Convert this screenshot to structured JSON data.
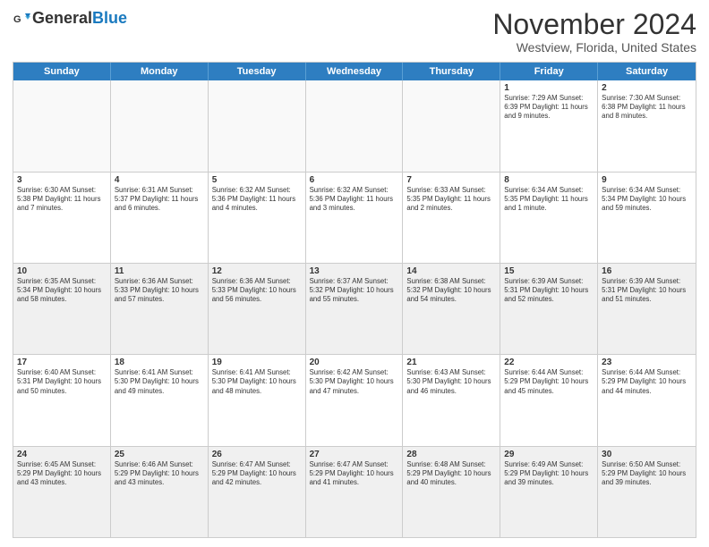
{
  "header": {
    "logo_general": "General",
    "logo_blue": "Blue",
    "month": "November 2024",
    "location": "Westview, Florida, United States"
  },
  "weekdays": [
    "Sunday",
    "Monday",
    "Tuesday",
    "Wednesday",
    "Thursday",
    "Friday",
    "Saturday"
  ],
  "weeks": [
    [
      {
        "day": "",
        "empty": true
      },
      {
        "day": "",
        "empty": true
      },
      {
        "day": "",
        "empty": true
      },
      {
        "day": "",
        "empty": true
      },
      {
        "day": "",
        "empty": true
      },
      {
        "day": "1",
        "info": "Sunrise: 7:29 AM\nSunset: 6:39 PM\nDaylight: 11 hours and 9 minutes."
      },
      {
        "day": "2",
        "info": "Sunrise: 7:30 AM\nSunset: 6:38 PM\nDaylight: 11 hours and 8 minutes."
      }
    ],
    [
      {
        "day": "3",
        "info": "Sunrise: 6:30 AM\nSunset: 5:38 PM\nDaylight: 11 hours and 7 minutes."
      },
      {
        "day": "4",
        "info": "Sunrise: 6:31 AM\nSunset: 5:37 PM\nDaylight: 11 hours and 6 minutes."
      },
      {
        "day": "5",
        "info": "Sunrise: 6:32 AM\nSunset: 5:36 PM\nDaylight: 11 hours and 4 minutes."
      },
      {
        "day": "6",
        "info": "Sunrise: 6:32 AM\nSunset: 5:36 PM\nDaylight: 11 hours and 3 minutes."
      },
      {
        "day": "7",
        "info": "Sunrise: 6:33 AM\nSunset: 5:35 PM\nDaylight: 11 hours and 2 minutes."
      },
      {
        "day": "8",
        "info": "Sunrise: 6:34 AM\nSunset: 5:35 PM\nDaylight: 11 hours and 1 minute."
      },
      {
        "day": "9",
        "info": "Sunrise: 6:34 AM\nSunset: 5:34 PM\nDaylight: 10 hours and 59 minutes."
      }
    ],
    [
      {
        "day": "10",
        "info": "Sunrise: 6:35 AM\nSunset: 5:34 PM\nDaylight: 10 hours and 58 minutes.",
        "shaded": true
      },
      {
        "day": "11",
        "info": "Sunrise: 6:36 AM\nSunset: 5:33 PM\nDaylight: 10 hours and 57 minutes.",
        "shaded": true
      },
      {
        "day": "12",
        "info": "Sunrise: 6:36 AM\nSunset: 5:33 PM\nDaylight: 10 hours and 56 minutes.",
        "shaded": true
      },
      {
        "day": "13",
        "info": "Sunrise: 6:37 AM\nSunset: 5:32 PM\nDaylight: 10 hours and 55 minutes.",
        "shaded": true
      },
      {
        "day": "14",
        "info": "Sunrise: 6:38 AM\nSunset: 5:32 PM\nDaylight: 10 hours and 54 minutes.",
        "shaded": true
      },
      {
        "day": "15",
        "info": "Sunrise: 6:39 AM\nSunset: 5:31 PM\nDaylight: 10 hours and 52 minutes.",
        "shaded": true
      },
      {
        "day": "16",
        "info": "Sunrise: 6:39 AM\nSunset: 5:31 PM\nDaylight: 10 hours and 51 minutes.",
        "shaded": true
      }
    ],
    [
      {
        "day": "17",
        "info": "Sunrise: 6:40 AM\nSunset: 5:31 PM\nDaylight: 10 hours and 50 minutes."
      },
      {
        "day": "18",
        "info": "Sunrise: 6:41 AM\nSunset: 5:30 PM\nDaylight: 10 hours and 49 minutes."
      },
      {
        "day": "19",
        "info": "Sunrise: 6:41 AM\nSunset: 5:30 PM\nDaylight: 10 hours and 48 minutes."
      },
      {
        "day": "20",
        "info": "Sunrise: 6:42 AM\nSunset: 5:30 PM\nDaylight: 10 hours and 47 minutes."
      },
      {
        "day": "21",
        "info": "Sunrise: 6:43 AM\nSunset: 5:30 PM\nDaylight: 10 hours and 46 minutes."
      },
      {
        "day": "22",
        "info": "Sunrise: 6:44 AM\nSunset: 5:29 PM\nDaylight: 10 hours and 45 minutes."
      },
      {
        "day": "23",
        "info": "Sunrise: 6:44 AM\nSunset: 5:29 PM\nDaylight: 10 hours and 44 minutes."
      }
    ],
    [
      {
        "day": "24",
        "info": "Sunrise: 6:45 AM\nSunset: 5:29 PM\nDaylight: 10 hours and 43 minutes.",
        "shaded": true
      },
      {
        "day": "25",
        "info": "Sunrise: 6:46 AM\nSunset: 5:29 PM\nDaylight: 10 hours and 43 minutes.",
        "shaded": true
      },
      {
        "day": "26",
        "info": "Sunrise: 6:47 AM\nSunset: 5:29 PM\nDaylight: 10 hours and 42 minutes.",
        "shaded": true
      },
      {
        "day": "27",
        "info": "Sunrise: 6:47 AM\nSunset: 5:29 PM\nDaylight: 10 hours and 41 minutes.",
        "shaded": true
      },
      {
        "day": "28",
        "info": "Sunrise: 6:48 AM\nSunset: 5:29 PM\nDaylight: 10 hours and 40 minutes.",
        "shaded": true
      },
      {
        "day": "29",
        "info": "Sunrise: 6:49 AM\nSunset: 5:29 PM\nDaylight: 10 hours and 39 minutes.",
        "shaded": true
      },
      {
        "day": "30",
        "info": "Sunrise: 6:50 AM\nSunset: 5:29 PM\nDaylight: 10 hours and 39 minutes.",
        "shaded": true
      }
    ]
  ]
}
